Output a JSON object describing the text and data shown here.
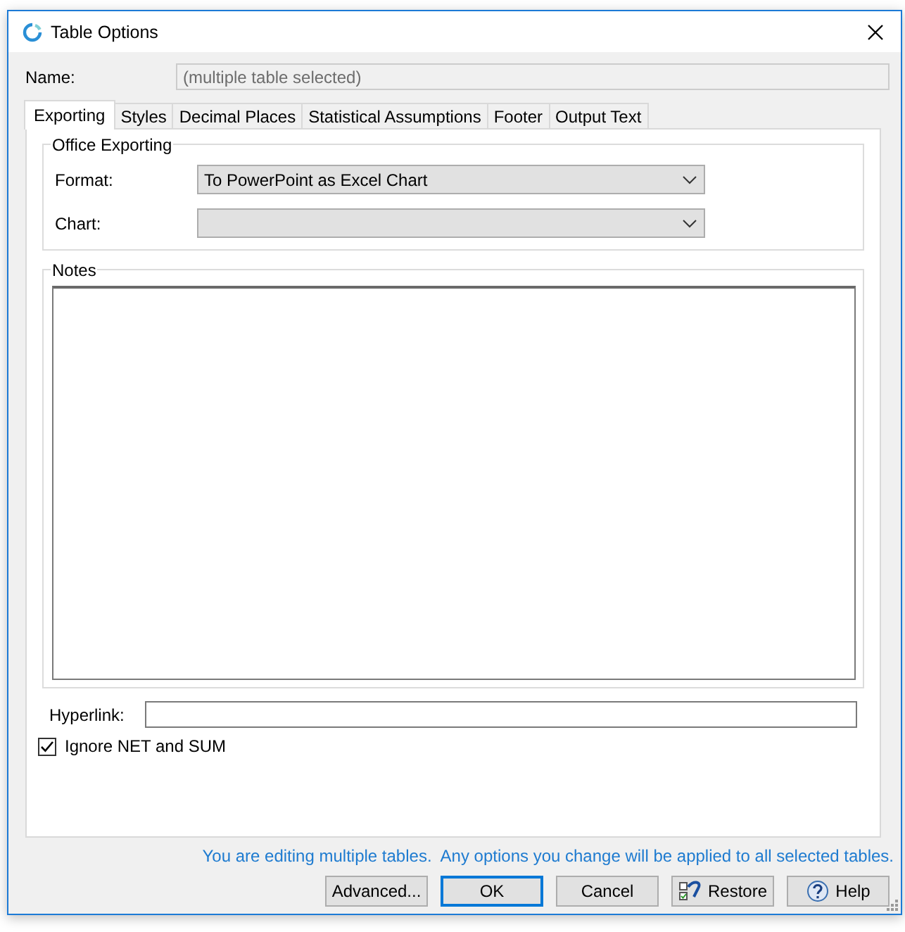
{
  "window": {
    "title": "Table Options"
  },
  "name": {
    "label": "Name:",
    "placeholder": "(multiple table selected)",
    "disabled": true
  },
  "tabs": [
    {
      "label": "Exporting",
      "selected": true
    },
    {
      "label": "Styles",
      "selected": false
    },
    {
      "label": "Decimal Places",
      "selected": false
    },
    {
      "label": "Statistical Assumptions",
      "selected": false
    },
    {
      "label": "Footer",
      "selected": false
    },
    {
      "label": "Output Text",
      "selected": false
    }
  ],
  "office_exporting": {
    "title": "Office Exporting",
    "fields": [
      {
        "label": "Format:",
        "value": "To PowerPoint as Excel Chart"
      },
      {
        "label": "Chart:"
      }
    ]
  },
  "notes": {
    "title": "Notes"
  },
  "hyperlink": {
    "label": "Hyperlink:"
  },
  "ignore_net_sum": {
    "label": "Ignore NET and SUM",
    "checked": true
  },
  "info": "You are editing multiple tables.  Any options you change will be applied to all selected tables.",
  "buttons": [
    {
      "label": "Advanced...",
      "kind": "plain",
      "default": false
    },
    {
      "label": "OK",
      "kind": "plain",
      "default": true
    },
    {
      "label": "Cancel",
      "kind": "plain",
      "default": false
    },
    {
      "label": "Restore",
      "kind": "restore",
      "default": false
    },
    {
      "label": "Help",
      "kind": "help",
      "default": false
    }
  ]
}
